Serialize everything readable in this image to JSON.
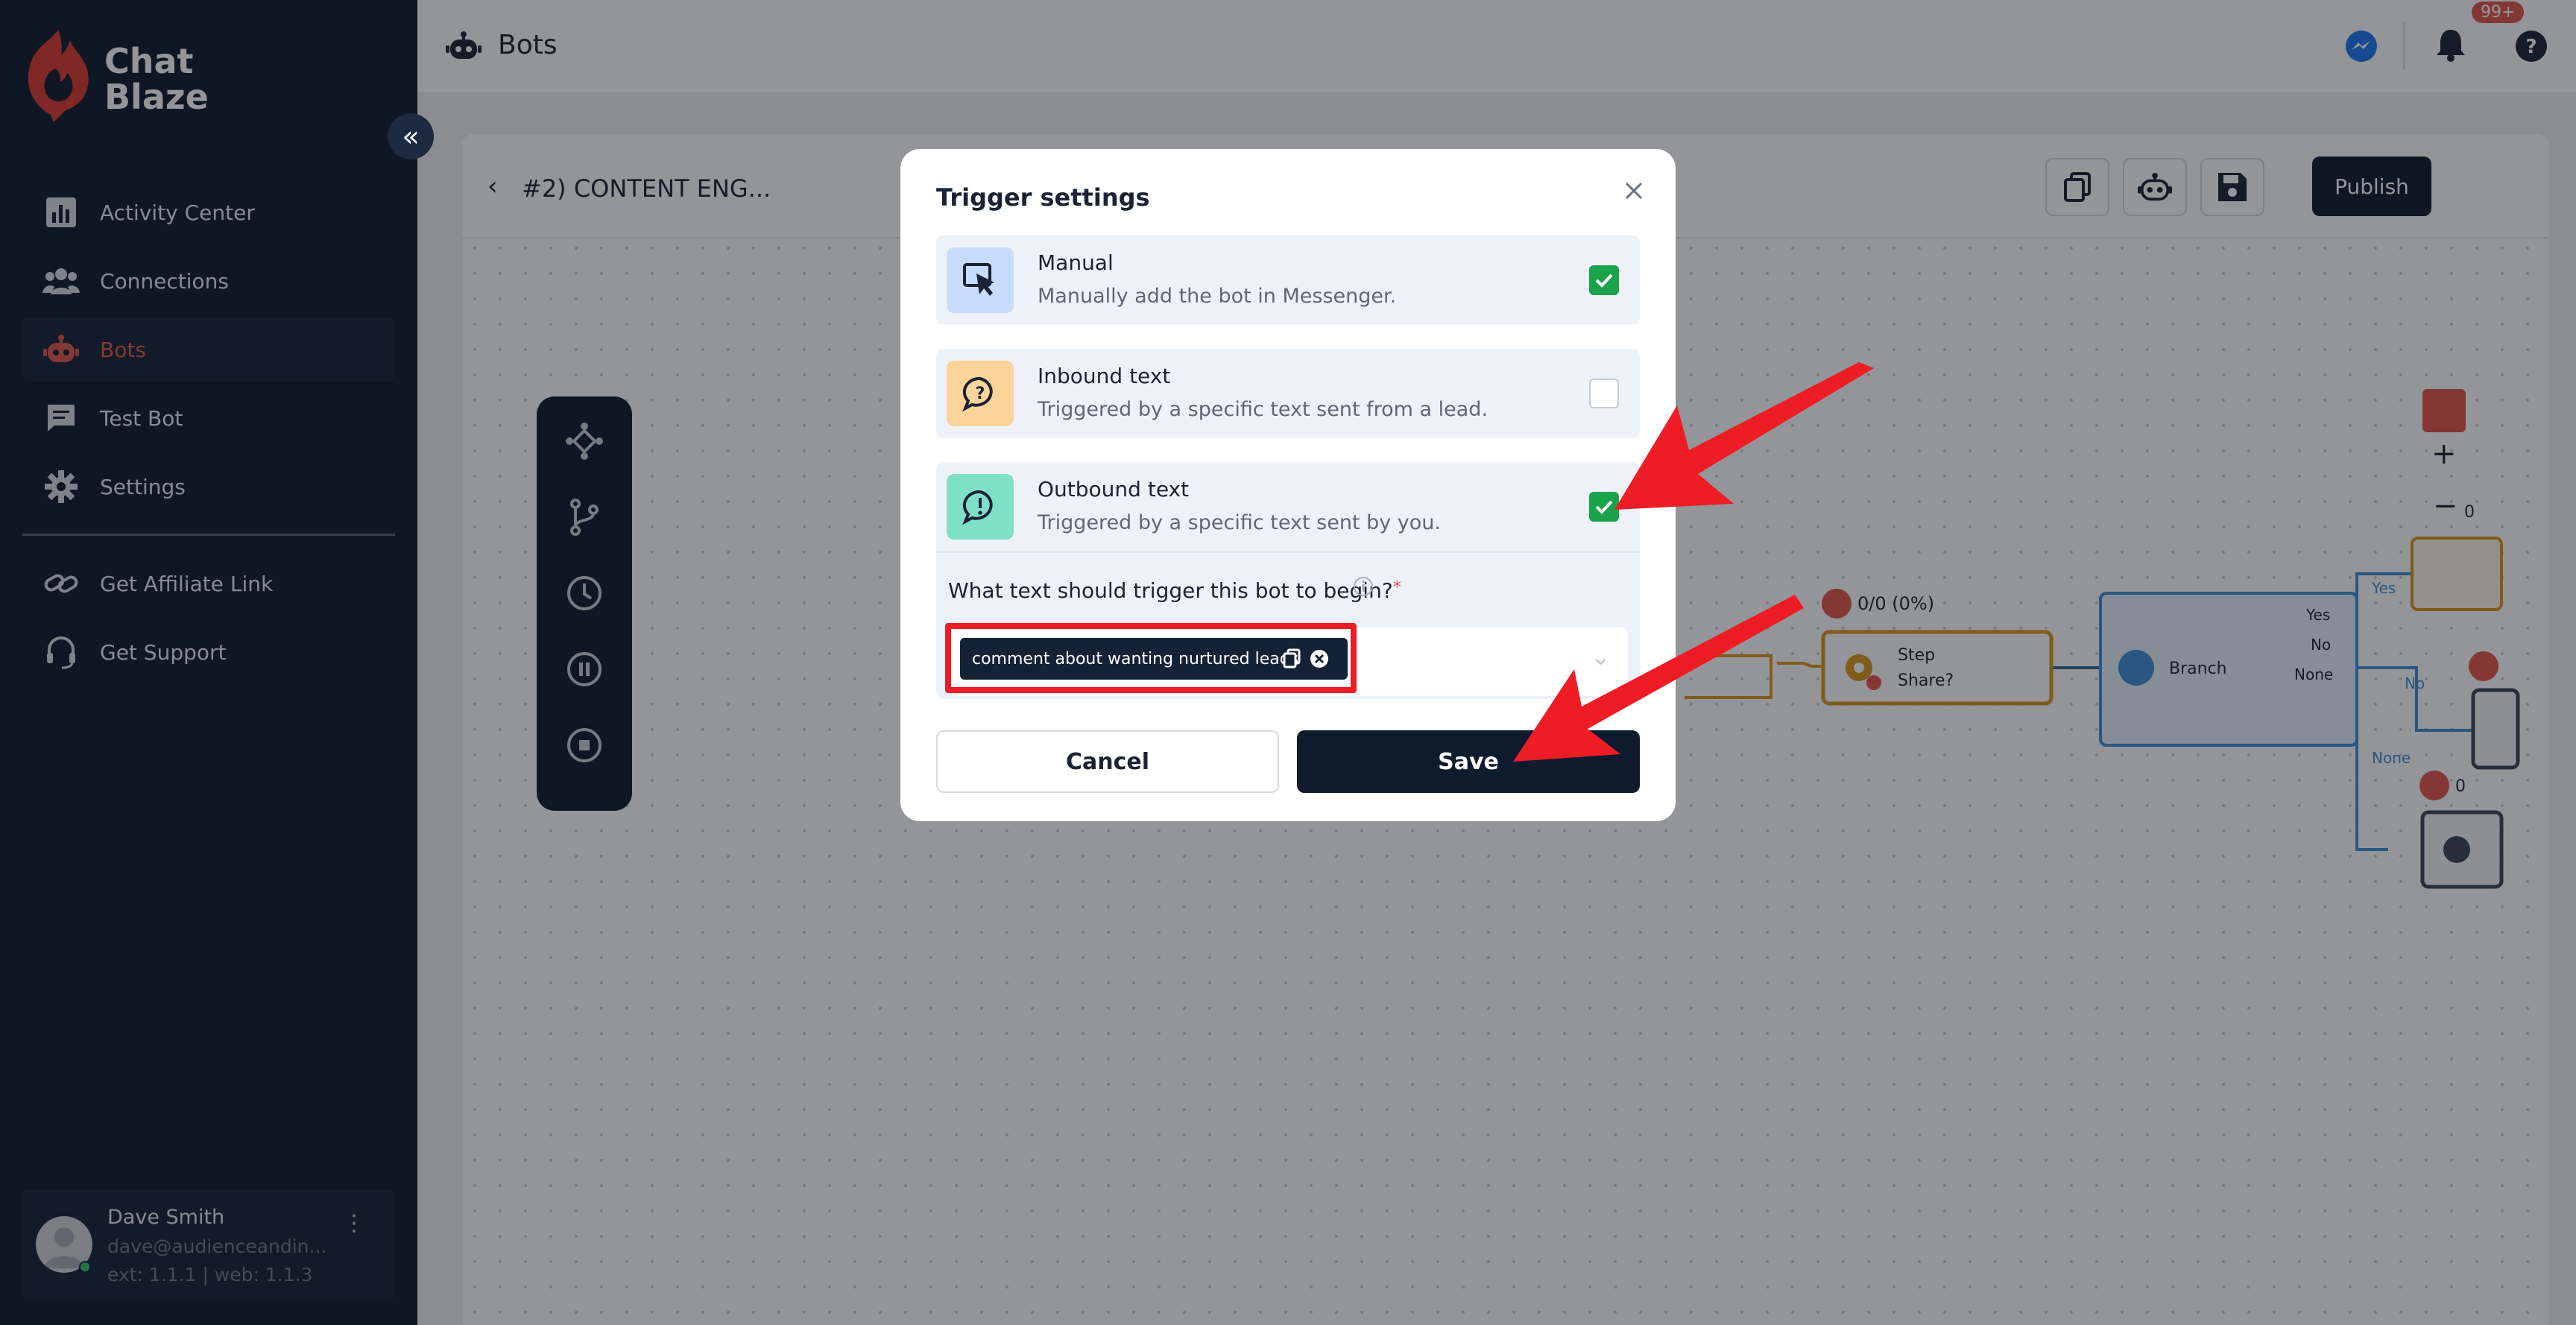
{
  "app": {
    "name": "Chat Blaze",
    "logo_line1": "Chat",
    "logo_line2": "Blaze",
    "collapse_icon": "chevrons-left-icon"
  },
  "sidebar": {
    "items": [
      {
        "label": "Activity Center",
        "icon": "bar-chart-icon",
        "active": false
      },
      {
        "label": "Connections",
        "icon": "users-icon",
        "active": false
      },
      {
        "label": "Bots",
        "icon": "robot-icon",
        "active": true
      },
      {
        "label": "Test Bot",
        "icon": "message-icon",
        "active": false
      },
      {
        "label": "Settings",
        "icon": "gear-icon",
        "active": false
      },
      {
        "label": "Get Affiliate Link",
        "icon": "link-icon",
        "active": false
      },
      {
        "label": "Get Support",
        "icon": "headset-icon",
        "active": false
      }
    ],
    "active_color": "#e2574c"
  },
  "user": {
    "name": "Dave Smith",
    "email": "dave@audienceandin...",
    "version": "ext: 1.1.1 | web: 1.1.3",
    "status_color": "#31c46a"
  },
  "topbar": {
    "title": "Bots",
    "notification_badge": "99+",
    "icons": [
      "messenger-icon",
      "bell-icon",
      "help-icon"
    ]
  },
  "editor": {
    "bot_name": "#2) CONTENT ENG...",
    "publish_label": "Publish",
    "header_icons": [
      "copy-icon",
      "robot-settings-icon",
      "save-icon"
    ],
    "tools": [
      "nodes-icon",
      "branch-icon",
      "clock-icon",
      "pause-icon",
      "stop-icon"
    ],
    "flow": {
      "stat_label": "0/0 (0%)",
      "step_title": "Step",
      "step_subtitle": "Share?",
      "branch_label": "Branch",
      "branch_outputs": [
        "Yes",
        "No",
        "None"
      ],
      "edge_labels": [
        "Yes",
        "No",
        "None"
      ],
      "side_counts": [
        "0",
        "0"
      ]
    }
  },
  "modal": {
    "title": "Trigger settings",
    "options": [
      {
        "title": "Manual",
        "description": "Manually add the bot in Messenger.",
        "checked": true,
        "icon": "cursor-click-icon",
        "icon_bg": "#c7dcfb"
      },
      {
        "title": "Inbound text",
        "description": "Triggered by a specific text sent from a lead.",
        "checked": false,
        "icon": "question-bubble-icon",
        "icon_bg": "#fcd49a"
      },
      {
        "title": "Outbound text",
        "description": "Triggered by a specific text sent by you.",
        "checked": true,
        "icon": "exclamation-bubble-icon",
        "icon_bg": "#7fe0c8"
      }
    ],
    "question": "What text should trigger this bot to begin?",
    "required_mark": "*",
    "tags": [
      "comment about wanting nurtured leads"
    ],
    "cancel_label": "Cancel",
    "save_label": "Save",
    "check_color": "#1aa34a"
  },
  "annotations": {
    "arrow_color": "#ee1c25",
    "highlight_color": "#ee1c25"
  }
}
